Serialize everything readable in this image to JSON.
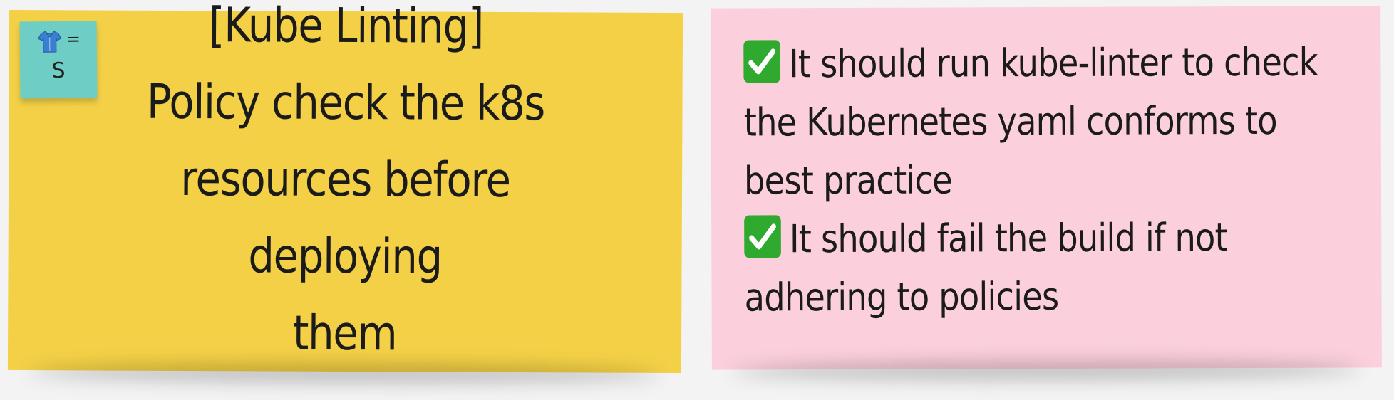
{
  "story_note": {
    "color": "#f3d046",
    "text": "[Kube Linting]\nPolicy check the k8s\nresources before deploying\nthem"
  },
  "size_tag": {
    "color": "#6ecdc4",
    "icon": "shirt-icon",
    "equals": "=",
    "size": "S"
  },
  "criteria_note": {
    "color": "#fbcfdc",
    "items": [
      {
        "icon": "check-mark-icon",
        "text": "It should run kube-linter to check the Kubernetes yaml conforms to best practice"
      },
      {
        "icon": "check-mark-icon",
        "text": "It should fail the build if not adhering to policies"
      }
    ]
  }
}
